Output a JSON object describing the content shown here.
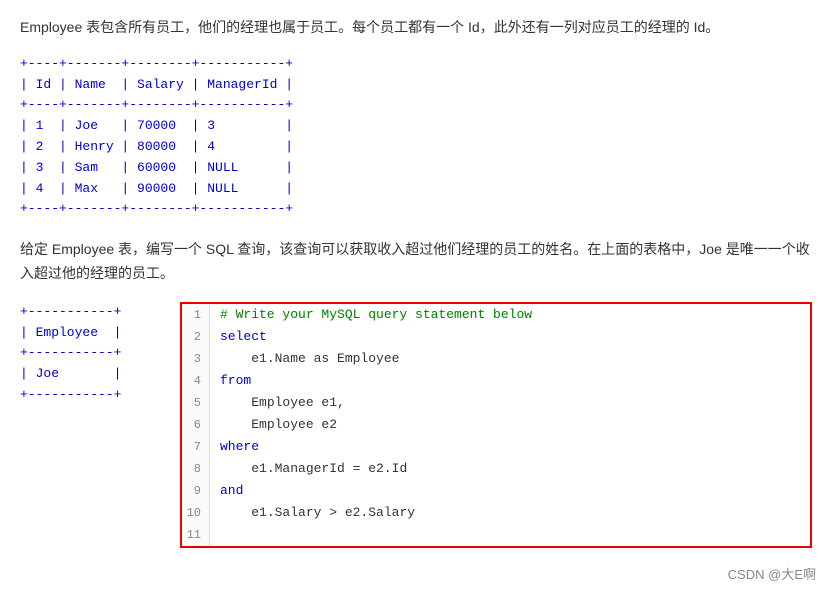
{
  "intro": {
    "text": "Employee 表包含所有员工，他们的经理也属于员工。每个员工都有一个 Id，此外还有一列对应员工的经理的 Id。"
  },
  "main_table": {
    "border": "+----+-------+--------+-----------+",
    "header": "| Id | Name  | Salary | ManagerId |",
    "rows": [
      "| 1  | Joe   | 70000  | 3         |",
      "| 2  | Henry | 80000  | 4         |",
      "| 3  | Sam   | 60000  | NULL      |",
      "| 4  | Max   | 90000  | NULL      |"
    ]
  },
  "desc": {
    "text": "给定 Employee 表，编写一个 SQL 查询，该查询可以获取收入超过他们经理的员工的姓名。在上面的表格中，Joe 是唯一一个收入超过他的经理的员工。"
  },
  "result_table": {
    "border": "+-----------+",
    "header": "| Employee  |",
    "rows": [
      "| Joe       |"
    ]
  },
  "code": {
    "lines": [
      {
        "num": "1",
        "tokens": [
          {
            "type": "comment",
            "text": "# Write your MySQL query statement below"
          }
        ]
      },
      {
        "num": "2",
        "tokens": [
          {
            "type": "kw",
            "text": "select"
          }
        ]
      },
      {
        "num": "3",
        "tokens": [
          {
            "type": "indent",
            "text": "    "
          },
          {
            "type": "ident",
            "text": "e1.Name as Employee"
          }
        ]
      },
      {
        "num": "4",
        "tokens": [
          {
            "type": "kw",
            "text": "from"
          }
        ]
      },
      {
        "num": "5",
        "tokens": [
          {
            "type": "indent",
            "text": "    "
          },
          {
            "type": "ident",
            "text": "Employee e1,"
          }
        ]
      },
      {
        "num": "6",
        "tokens": [
          {
            "type": "indent",
            "text": "    "
          },
          {
            "type": "ident",
            "text": "Employee e2"
          }
        ]
      },
      {
        "num": "7",
        "tokens": [
          {
            "type": "kw",
            "text": "where"
          }
        ]
      },
      {
        "num": "8",
        "tokens": [
          {
            "type": "indent",
            "text": "    "
          },
          {
            "type": "ident",
            "text": "e1.ManagerId = e2.Id"
          }
        ]
      },
      {
        "num": "9",
        "tokens": [
          {
            "type": "kw",
            "text": "and"
          }
        ]
      },
      {
        "num": "10",
        "tokens": [
          {
            "type": "indent",
            "text": "    "
          },
          {
            "type": "ident",
            "text": "e1.Salary > e2.Salary"
          }
        ]
      },
      {
        "num": "11",
        "tokens": []
      }
    ]
  },
  "watermark": "CSDN @大E啊"
}
